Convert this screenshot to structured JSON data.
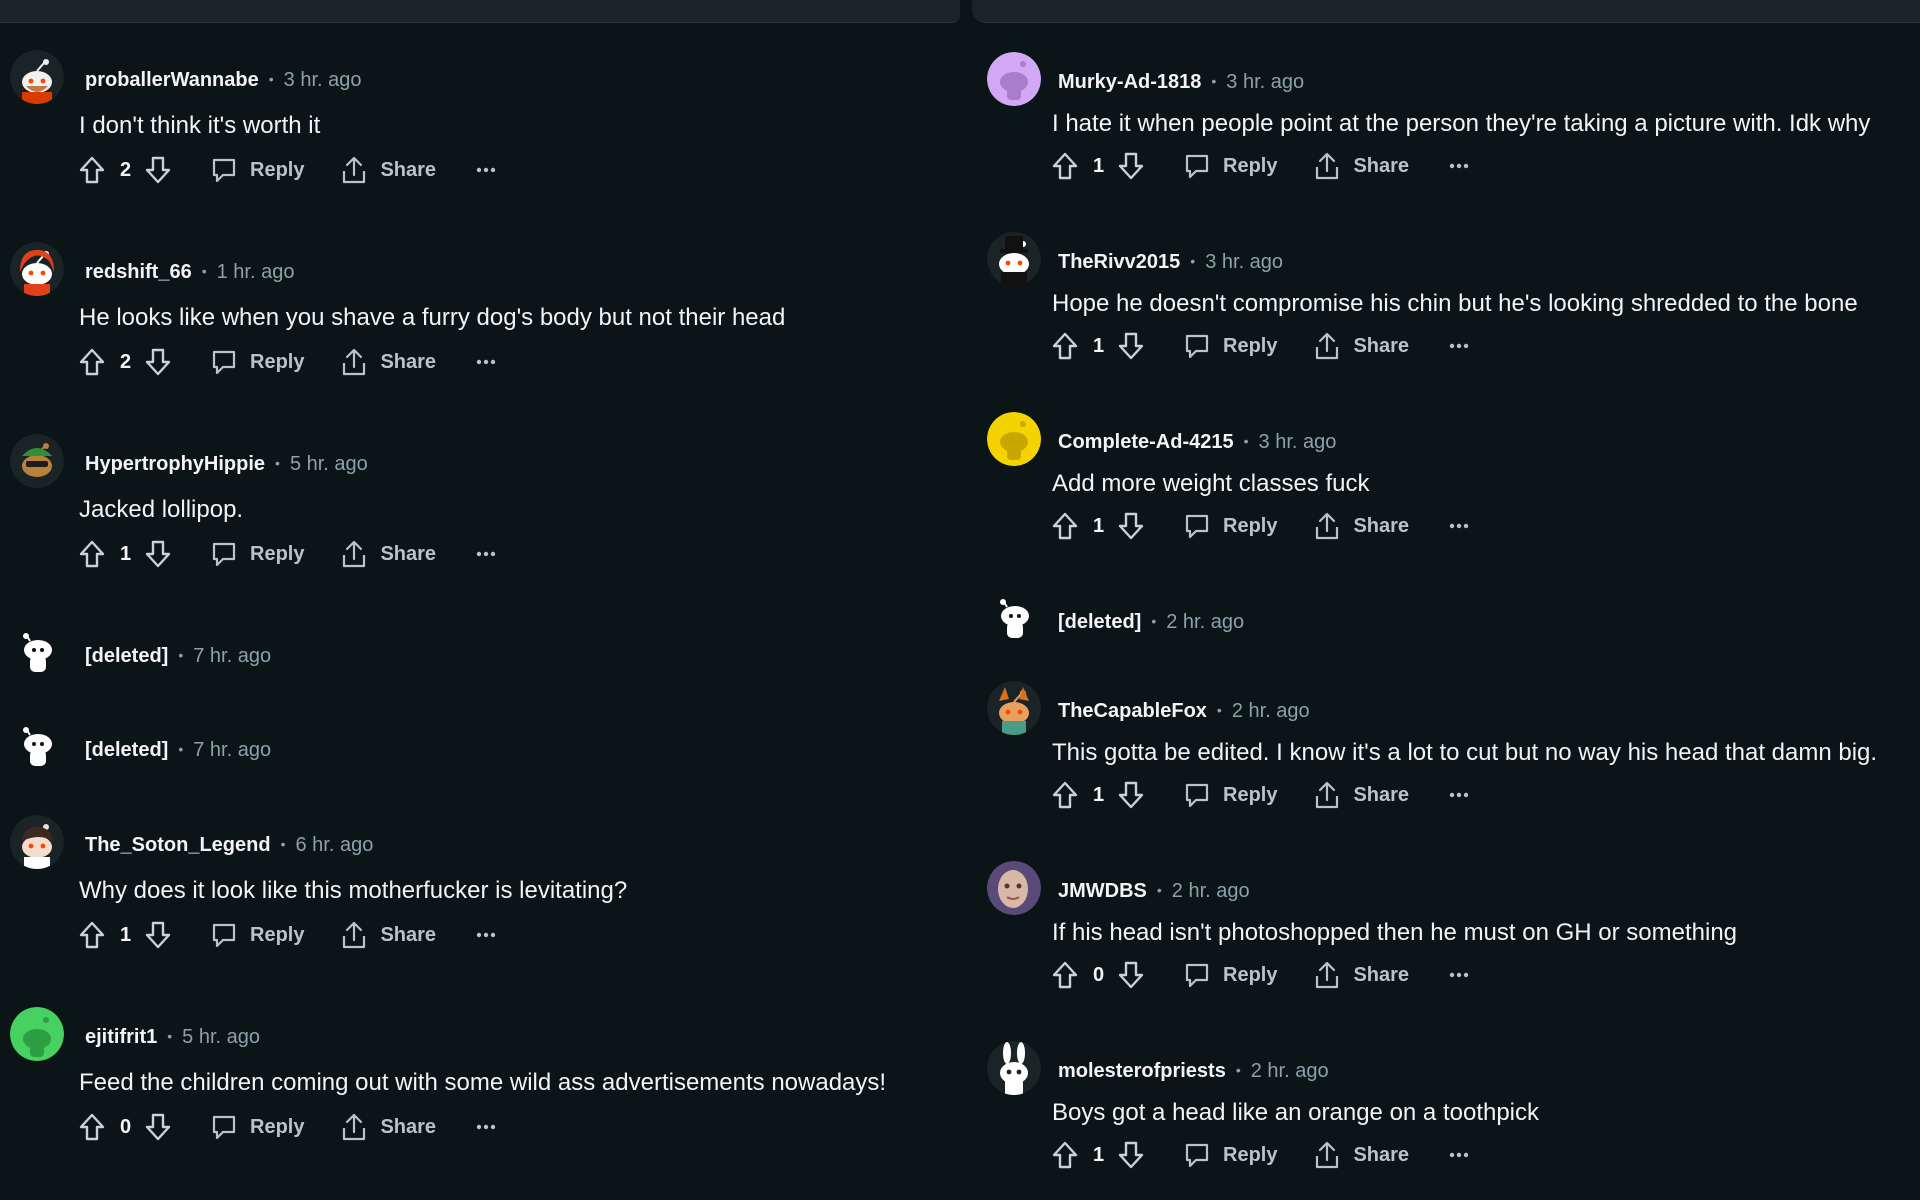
{
  "actions": {
    "reply": "Reply",
    "share": "Share"
  },
  "colors": {
    "background": "#0b1416",
    "text": "#f2f4f5",
    "muted": "#8ba2ad"
  },
  "left_comments": [
    {
      "author": "proballerWannabe",
      "time": "3 hr. ago",
      "body": "I don't think it's worth it",
      "score": "2",
      "avatar": "snoo-bearded"
    },
    {
      "author": "redshift_66",
      "time": "1 hr. ago",
      "body": "He looks like when you shave a furry dog's body but not their head",
      "score": "2",
      "avatar": "snoo-red-hood"
    },
    {
      "author": "HypertrophyHippie",
      "time": "5 hr. ago",
      "body": "Jacked lollipop.",
      "score": "1",
      "avatar": "snoo-green-sunglasses"
    },
    {
      "author": "[deleted]",
      "time": "7 hr. ago",
      "avatar": "snoo-default-white"
    },
    {
      "author": "[deleted]",
      "time": "7 hr. ago",
      "avatar": "snoo-default-white"
    },
    {
      "author": "The_Soton_Legend",
      "time": "6 hr. ago",
      "body": "Why does it look like this motherfucker is levitating?",
      "score": "1",
      "avatar": "snoo-dark-hair"
    },
    {
      "author": "ejitifrit1",
      "time": "5 hr. ago",
      "body": "Feed the children coming out with some wild ass advertisements nowadays!",
      "score": "0",
      "avatar": "snoo-green-default"
    }
  ],
  "right_comments": [
    {
      "author": "Murky-Ad-1818",
      "time": "3 hr. ago",
      "body": "I hate it when people point at the person they're taking a picture with. Idk why",
      "score": "1",
      "avatar": "snoo-purple-default"
    },
    {
      "author": "TheRivv2015",
      "time": "3 hr. ago",
      "body": "Hope he doesn't compromise his chin but he's looking shredded to the bone",
      "score": "1",
      "avatar": "snoo-top-hat"
    },
    {
      "author": "Complete-Ad-4215",
      "time": "3 hr. ago",
      "body": "Add more weight classes fuck",
      "score": "1",
      "avatar": "snoo-yellow-default"
    },
    {
      "author": "[deleted]",
      "time": "2 hr. ago",
      "avatar": "snoo-default-white"
    },
    {
      "author": "TheCapableFox",
      "time": "2 hr. ago",
      "body": "This gotta be edited. I know it's a lot to cut but no way his head that damn big.",
      "score": "1",
      "avatar": "snoo-fox"
    },
    {
      "author": "JMWDBS",
      "time": "2 hr. ago",
      "body": "If his head isn't photoshopped then he must on GH or something",
      "score": "0",
      "avatar": "photo-face"
    },
    {
      "author": "molesterofpriests",
      "time": "2 hr. ago",
      "body": "Boys got a head like an orange on a toothpick",
      "score": "1",
      "avatar": "snoo-bunny"
    }
  ]
}
